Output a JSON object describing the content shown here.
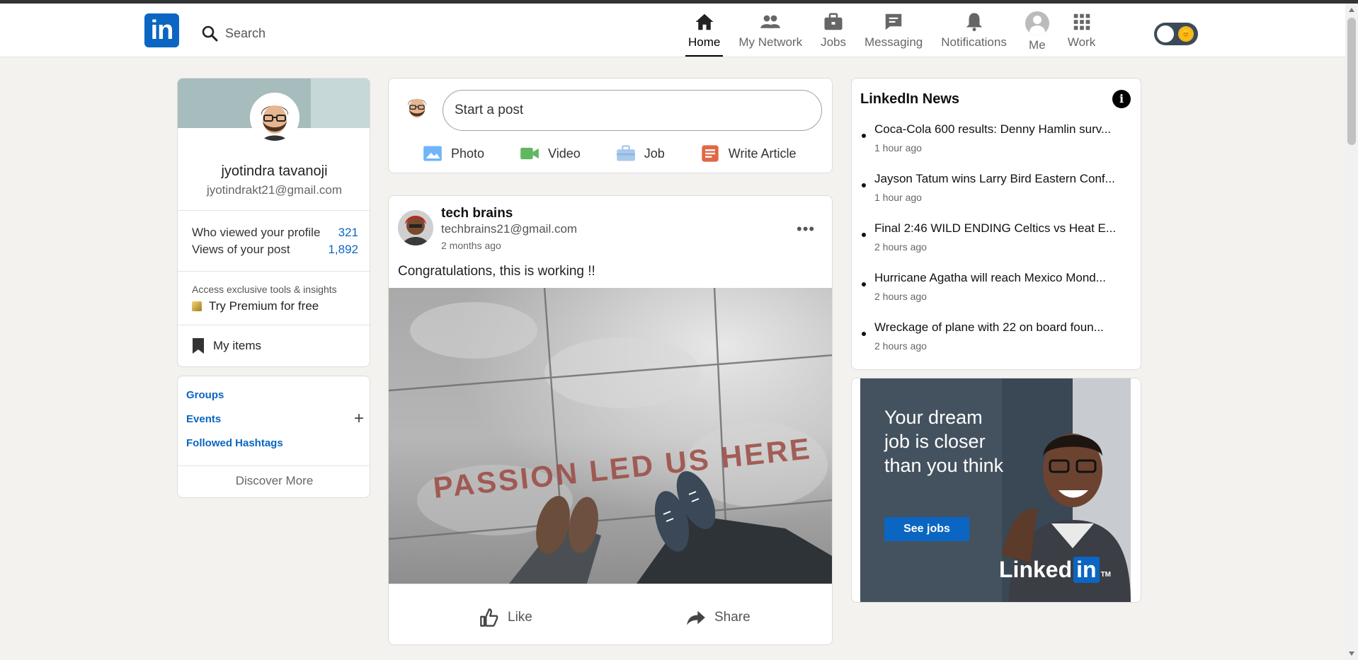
{
  "header": {
    "logo_text": "in",
    "search_placeholder": "Search",
    "nav": [
      {
        "label": "Home",
        "icon": "home-icon"
      },
      {
        "label": "My Network",
        "icon": "network-icon"
      },
      {
        "label": "Jobs",
        "icon": "briefcase-icon"
      },
      {
        "label": "Messaging",
        "icon": "message-icon"
      },
      {
        "label": "Notifications",
        "icon": "bell-icon"
      },
      {
        "label": "Me",
        "icon": "avatar-icon"
      },
      {
        "label": "Work",
        "icon": "grid-icon"
      }
    ],
    "theme_toggle_emoji": "🌞"
  },
  "profile": {
    "name": "jyotindra tavanoji",
    "email": "jyotindrakt21@gmail.com",
    "stats": [
      {
        "label": "Who viewed your profile",
        "value": "321"
      },
      {
        "label": "Views of your post",
        "value": "1,892"
      }
    ],
    "access_text": "Access exclusive tools & insights",
    "premium_text": "Try Premium for free",
    "my_items": "My items"
  },
  "groups": {
    "links": [
      "Groups",
      "Events",
      "Followed Hashtags"
    ],
    "plus": "+",
    "discover": "Discover More"
  },
  "share": {
    "start_post": "Start a post",
    "actions": [
      {
        "label": "Photo",
        "color": "#70b5f9"
      },
      {
        "label": "Video",
        "color": "#5fb760"
      },
      {
        "label": "Job",
        "color": "#a8c9ec"
      },
      {
        "label": "Write Article",
        "color": "#e16745"
      }
    ]
  },
  "post": {
    "author": "tech brains",
    "email": "techbrains21@gmail.com",
    "time": "2 months ago",
    "more": "•••",
    "text": "Congratulations, this is working !!",
    "photo_caption": "PASSION LED US HERE",
    "actions": [
      "Like",
      "Share"
    ]
  },
  "news": {
    "title": "LinkedIn News",
    "info": "i",
    "items": [
      {
        "headline": "Coca-Cola 600 results: Denny Hamlin surv...",
        "time": "1 hour ago"
      },
      {
        "headline": "Jayson Tatum wins Larry Bird Eastern Conf...",
        "time": "1 hour ago"
      },
      {
        "headline": "Final 2:46 WILD ENDING Celtics vs Heat E...",
        "time": "2 hours ago"
      },
      {
        "headline": "Hurricane Agatha will reach Mexico Mond...",
        "time": "2 hours ago"
      },
      {
        "headline": "Wreckage of plane with 22 on board foun...",
        "time": "2 hours ago"
      }
    ]
  },
  "ad": {
    "headline": "Your dream job is closer than you think",
    "button": "See jobs",
    "brand_linked": "Linked",
    "brand_in": "in",
    "tm": "TM"
  },
  "colors": {
    "brand_blue": "#0a66c2",
    "background": "#f3f2ef"
  }
}
